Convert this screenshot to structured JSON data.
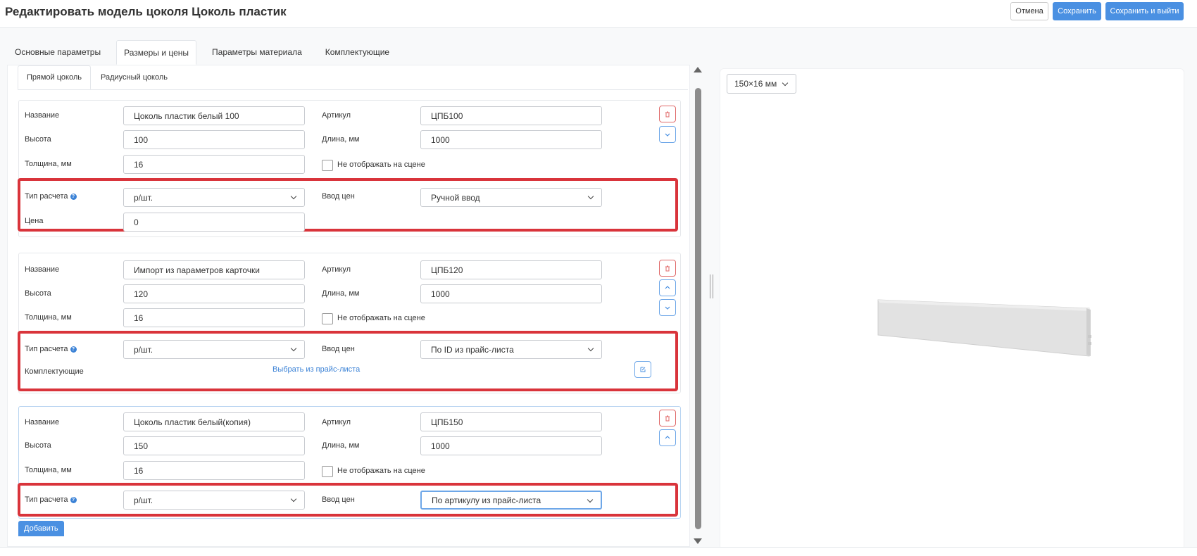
{
  "header": {
    "title": "Редактировать модель цоколя Цоколь пластик",
    "cancel_label": "Отмена",
    "save_label": "Сохранить",
    "save_exit_label": "Сохранить и выйти"
  },
  "tabs": [
    {
      "label": "Основные параметры",
      "active": false
    },
    {
      "label": "Размеры и цены",
      "active": true
    },
    {
      "label": "Параметры материала",
      "active": false
    },
    {
      "label": "Комплектующие",
      "active": false
    }
  ],
  "subtabs": [
    {
      "label": "Прямой цоколь",
      "active": true
    },
    {
      "label": "Радиусный цоколь",
      "active": false
    }
  ],
  "labels": {
    "name": "Название",
    "article": "Артикул",
    "height": "Высота",
    "length": "Длина, мм",
    "thickness": "Толщина, мм",
    "hide_on_scene": "Не отображать на сцене",
    "calc_type": "Тип расчета",
    "price_input": "Ввод цен",
    "price": "Цена",
    "accessories": "Комплектующие",
    "help": "?"
  },
  "items": [
    {
      "name": "Цоколь пластик белый 100",
      "article": "ЦПБ100",
      "height": "100",
      "length": "1000",
      "thickness": "16",
      "calc_type": "р/шт.",
      "price_input": "Ручной ввод",
      "price": "0"
    },
    {
      "name": "Импорт из параметров карточки",
      "article": "ЦПБ120",
      "height": "120",
      "length": "1000",
      "thickness": "16",
      "calc_type": "р/шт.",
      "price_input": "По ID из прайс-листа",
      "accessories_link": "Выбрать из прайс-листа"
    },
    {
      "name": "Цоколь пластик белый(копия)",
      "article": "ЦПБ150",
      "height": "150",
      "length": "1000",
      "thickness": "16",
      "calc_type": "р/шт.",
      "price_input": "По артикулу из прайс-листа"
    }
  ],
  "add_label": "Добавить",
  "preview": {
    "size_select": "150×16 мм"
  },
  "colors": {
    "primary": "#4a90e2",
    "highlight": "#d9343b",
    "delete": "#e06a6a"
  }
}
